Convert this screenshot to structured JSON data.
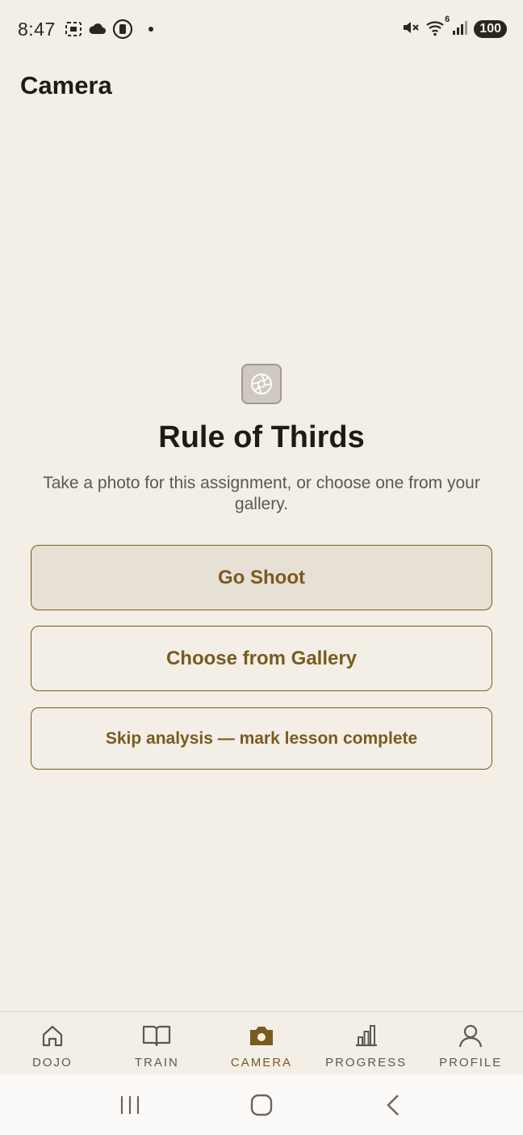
{
  "status_bar": {
    "time": "8:47",
    "battery": "100",
    "signal_superscript": "6"
  },
  "header": {
    "title": "Camera"
  },
  "lesson": {
    "icon": "aperture-icon",
    "title": "Rule of Thirds",
    "description": "Take a photo for this assignment, or choose one from your gallery."
  },
  "actions": {
    "primary_label": "Go Shoot",
    "gallery_label": "Choose from Gallery",
    "skip_label": "Skip analysis — mark lesson complete"
  },
  "bottom_nav": {
    "items": [
      {
        "label": "DOJO",
        "icon": "home-icon",
        "active": false
      },
      {
        "label": "TRAIN",
        "icon": "book-icon",
        "active": false
      },
      {
        "label": "CAMERA",
        "icon": "camera-icon",
        "active": true
      },
      {
        "label": "PROGRESS",
        "icon": "bar-chart-icon",
        "active": false
      },
      {
        "label": "PROFILE",
        "icon": "person-icon",
        "active": false
      }
    ]
  },
  "colors": {
    "background": "#f3efe7",
    "accent": "#7a5a1f",
    "text": "#1f1a14",
    "muted": "#5d5750"
  }
}
